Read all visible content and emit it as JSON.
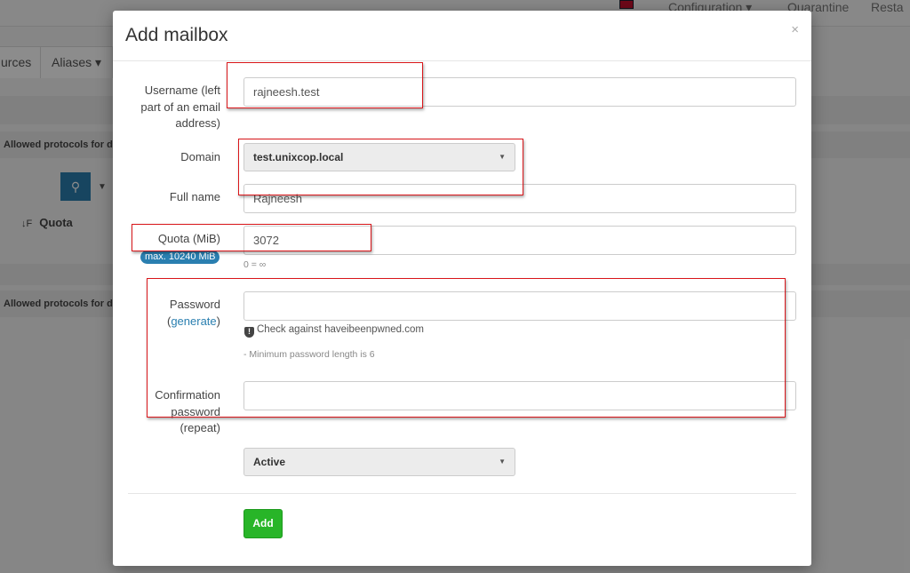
{
  "background": {
    "nav": {
      "configuration": "Configuration ▾",
      "quarantine": "Quarantine",
      "restart": "Resta"
    },
    "tabs": {
      "resources": "urces",
      "aliases": "Aliases ▾"
    },
    "allowed_protocols_1": "Allowed protocols for di",
    "allowed_protocols_2": "Allowed protocols for di",
    "search_icon": "search-icon",
    "quota_header": "Quota",
    "sort_icon": "↓F"
  },
  "modal": {
    "title": "Add mailbox",
    "close": "×",
    "username": {
      "label_line1": "Username (left",
      "label_line2": "part of an email",
      "label_line3": "address)",
      "value": "rajneesh.test"
    },
    "domain": {
      "label": "Domain",
      "selected": "test.unixcop.local"
    },
    "full_name": {
      "label": "Full name",
      "value": "Rajneesh"
    },
    "quota": {
      "label": "Quota (MiB)",
      "value": "3072",
      "max_badge": "max. 10240 MiB",
      "help": "0 = ∞"
    },
    "password": {
      "label": "Password",
      "generate_link": "generate",
      "value": "",
      "pwned_check": "Check against haveibeenpwned.com",
      "min_length": "- Minimum password length is 6"
    },
    "confirmation": {
      "label_line1": "Confirmation",
      "label_line2": "password",
      "label_line3": "(repeat)",
      "value": ""
    },
    "status": {
      "selected": "Active"
    },
    "add_button": "Add"
  },
  "colors": {
    "annotation_red": "#d9161a",
    "add_green": "#28b528",
    "accent_blue": "#2a7fb0"
  }
}
